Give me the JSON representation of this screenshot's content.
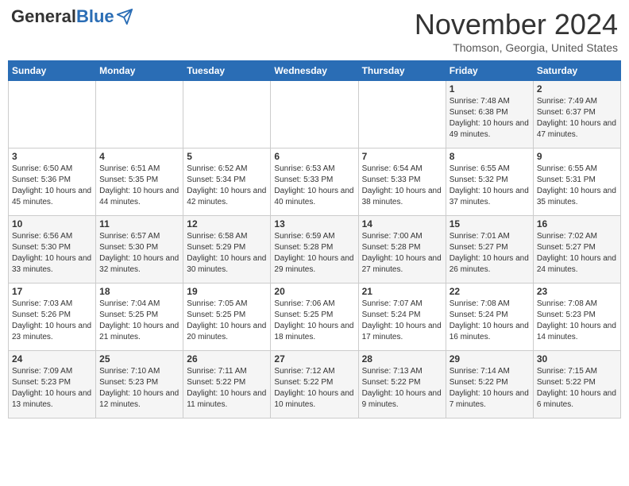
{
  "header": {
    "logo_general": "General",
    "logo_blue": "Blue",
    "month_title": "November 2024",
    "location": "Thomson, Georgia, United States"
  },
  "days_of_week": [
    "Sunday",
    "Monday",
    "Tuesday",
    "Wednesday",
    "Thursday",
    "Friday",
    "Saturday"
  ],
  "weeks": [
    [
      {
        "day": "",
        "info": ""
      },
      {
        "day": "",
        "info": ""
      },
      {
        "day": "",
        "info": ""
      },
      {
        "day": "",
        "info": ""
      },
      {
        "day": "",
        "info": ""
      },
      {
        "day": "1",
        "info": "Sunrise: 7:48 AM\nSunset: 6:38 PM\nDaylight: 10 hours and 49 minutes."
      },
      {
        "day": "2",
        "info": "Sunrise: 7:49 AM\nSunset: 6:37 PM\nDaylight: 10 hours and 47 minutes."
      }
    ],
    [
      {
        "day": "3",
        "info": "Sunrise: 6:50 AM\nSunset: 5:36 PM\nDaylight: 10 hours and 45 minutes."
      },
      {
        "day": "4",
        "info": "Sunrise: 6:51 AM\nSunset: 5:35 PM\nDaylight: 10 hours and 44 minutes."
      },
      {
        "day": "5",
        "info": "Sunrise: 6:52 AM\nSunset: 5:34 PM\nDaylight: 10 hours and 42 minutes."
      },
      {
        "day": "6",
        "info": "Sunrise: 6:53 AM\nSunset: 5:33 PM\nDaylight: 10 hours and 40 minutes."
      },
      {
        "day": "7",
        "info": "Sunrise: 6:54 AM\nSunset: 5:33 PM\nDaylight: 10 hours and 38 minutes."
      },
      {
        "day": "8",
        "info": "Sunrise: 6:55 AM\nSunset: 5:32 PM\nDaylight: 10 hours and 37 minutes."
      },
      {
        "day": "9",
        "info": "Sunrise: 6:55 AM\nSunset: 5:31 PM\nDaylight: 10 hours and 35 minutes."
      }
    ],
    [
      {
        "day": "10",
        "info": "Sunrise: 6:56 AM\nSunset: 5:30 PM\nDaylight: 10 hours and 33 minutes."
      },
      {
        "day": "11",
        "info": "Sunrise: 6:57 AM\nSunset: 5:30 PM\nDaylight: 10 hours and 32 minutes."
      },
      {
        "day": "12",
        "info": "Sunrise: 6:58 AM\nSunset: 5:29 PM\nDaylight: 10 hours and 30 minutes."
      },
      {
        "day": "13",
        "info": "Sunrise: 6:59 AM\nSunset: 5:28 PM\nDaylight: 10 hours and 29 minutes."
      },
      {
        "day": "14",
        "info": "Sunrise: 7:00 AM\nSunset: 5:28 PM\nDaylight: 10 hours and 27 minutes."
      },
      {
        "day": "15",
        "info": "Sunrise: 7:01 AM\nSunset: 5:27 PM\nDaylight: 10 hours and 26 minutes."
      },
      {
        "day": "16",
        "info": "Sunrise: 7:02 AM\nSunset: 5:27 PM\nDaylight: 10 hours and 24 minutes."
      }
    ],
    [
      {
        "day": "17",
        "info": "Sunrise: 7:03 AM\nSunset: 5:26 PM\nDaylight: 10 hours and 23 minutes."
      },
      {
        "day": "18",
        "info": "Sunrise: 7:04 AM\nSunset: 5:25 PM\nDaylight: 10 hours and 21 minutes."
      },
      {
        "day": "19",
        "info": "Sunrise: 7:05 AM\nSunset: 5:25 PM\nDaylight: 10 hours and 20 minutes."
      },
      {
        "day": "20",
        "info": "Sunrise: 7:06 AM\nSunset: 5:25 PM\nDaylight: 10 hours and 18 minutes."
      },
      {
        "day": "21",
        "info": "Sunrise: 7:07 AM\nSunset: 5:24 PM\nDaylight: 10 hours and 17 minutes."
      },
      {
        "day": "22",
        "info": "Sunrise: 7:08 AM\nSunset: 5:24 PM\nDaylight: 10 hours and 16 minutes."
      },
      {
        "day": "23",
        "info": "Sunrise: 7:08 AM\nSunset: 5:23 PM\nDaylight: 10 hours and 14 minutes."
      }
    ],
    [
      {
        "day": "24",
        "info": "Sunrise: 7:09 AM\nSunset: 5:23 PM\nDaylight: 10 hours and 13 minutes."
      },
      {
        "day": "25",
        "info": "Sunrise: 7:10 AM\nSunset: 5:23 PM\nDaylight: 10 hours and 12 minutes."
      },
      {
        "day": "26",
        "info": "Sunrise: 7:11 AM\nSunset: 5:22 PM\nDaylight: 10 hours and 11 minutes."
      },
      {
        "day": "27",
        "info": "Sunrise: 7:12 AM\nSunset: 5:22 PM\nDaylight: 10 hours and 10 minutes."
      },
      {
        "day": "28",
        "info": "Sunrise: 7:13 AM\nSunset: 5:22 PM\nDaylight: 10 hours and 9 minutes."
      },
      {
        "day": "29",
        "info": "Sunrise: 7:14 AM\nSunset: 5:22 PM\nDaylight: 10 hours and 7 minutes."
      },
      {
        "day": "30",
        "info": "Sunrise: 7:15 AM\nSunset: 5:22 PM\nDaylight: 10 hours and 6 minutes."
      }
    ]
  ]
}
